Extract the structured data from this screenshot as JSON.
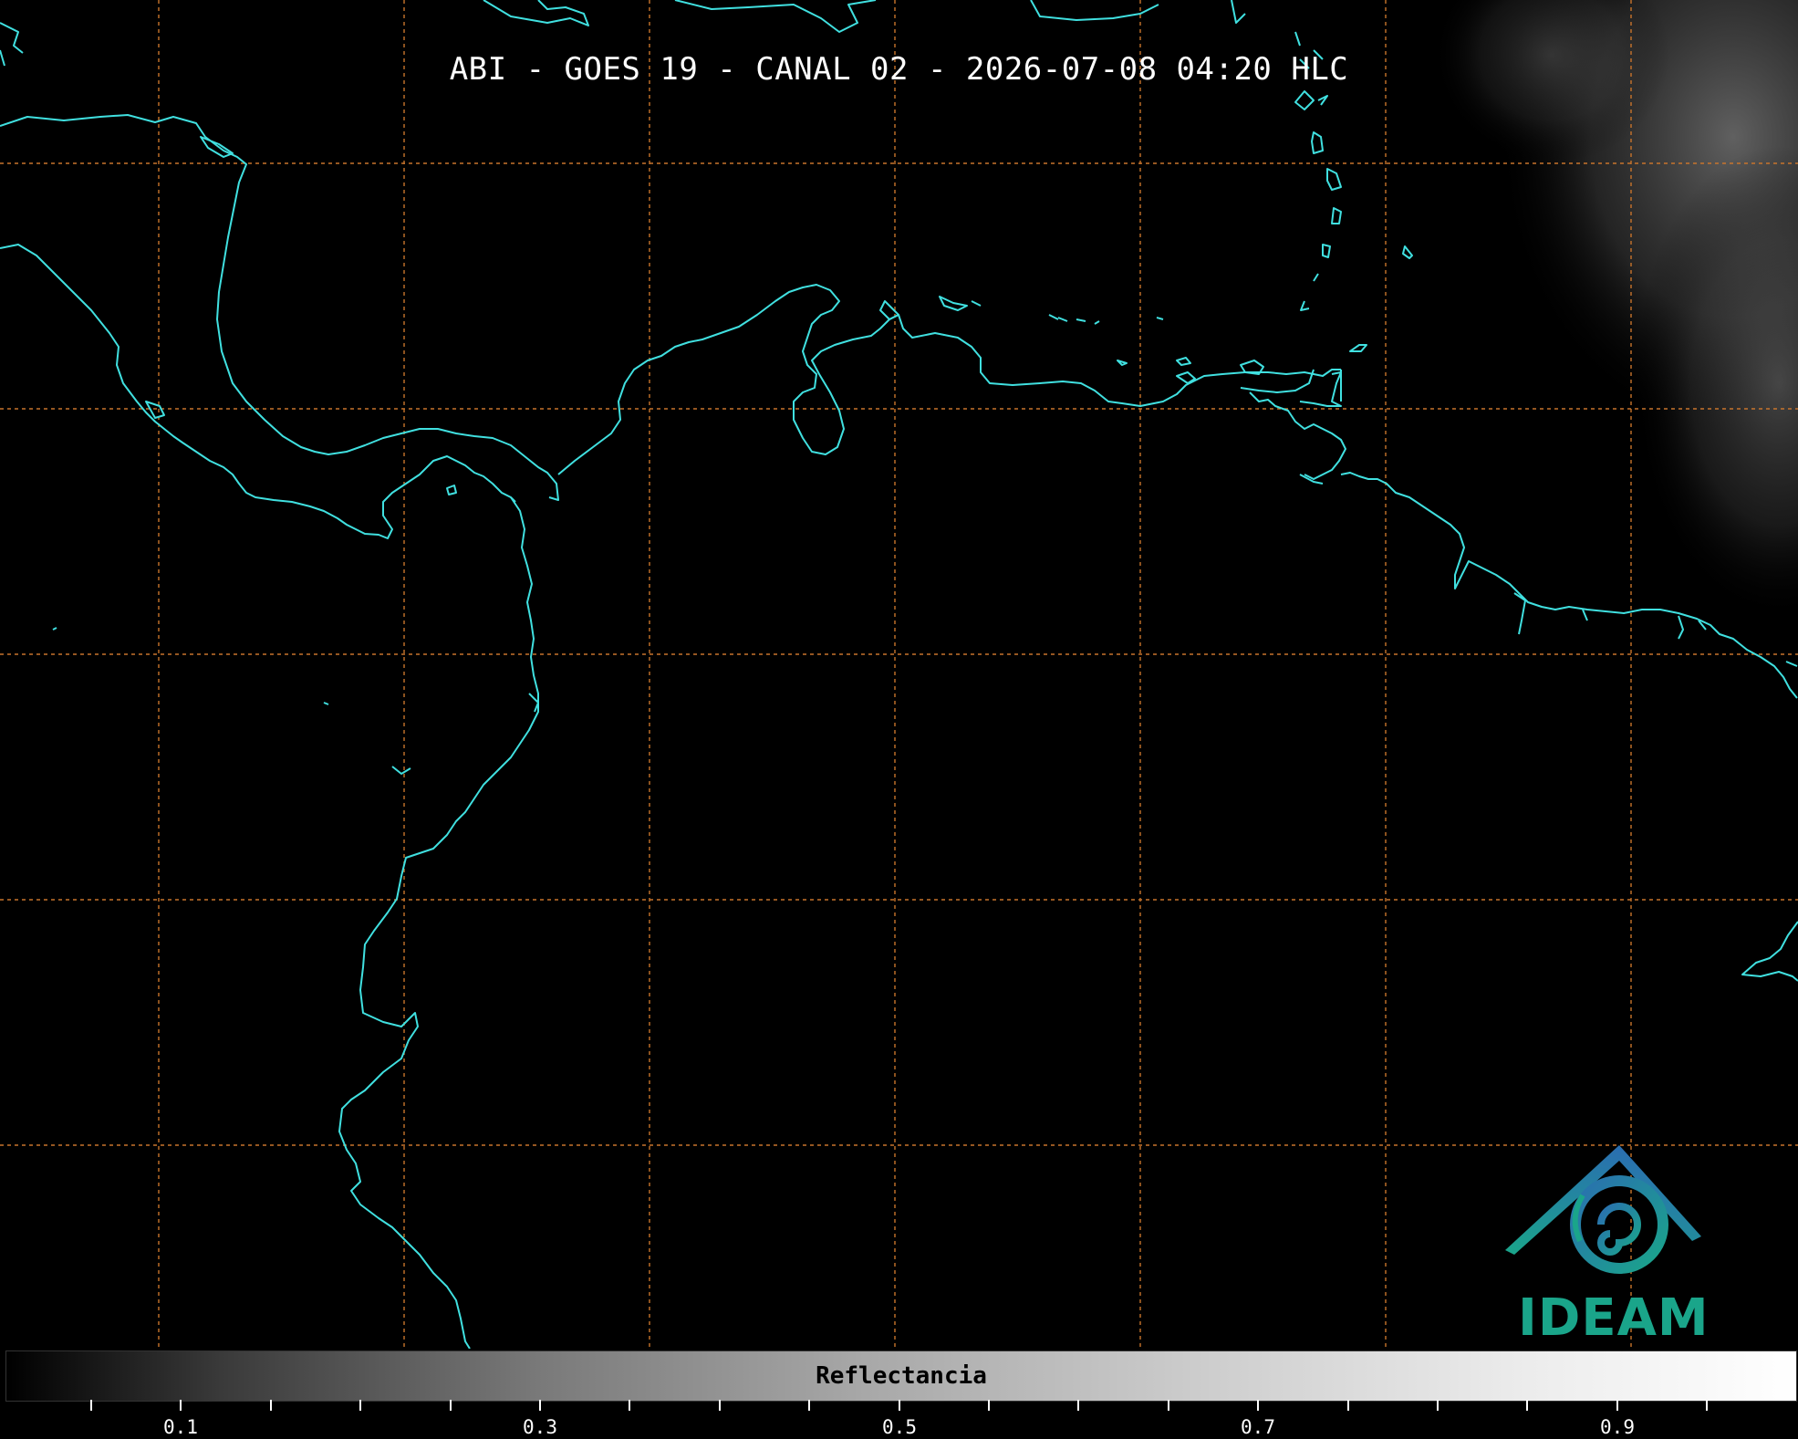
{
  "title": "ABI - GOES 19 - CANAL 02 - 2026-07-08 04:20 HLC",
  "colorbar": {
    "label": "Reflectancia",
    "ticks": [
      "0.1",
      "0.3",
      "0.5",
      "0.7",
      "0.9"
    ],
    "range": [
      0.0,
      1.0
    ]
  },
  "logo": {
    "text": "IDEAM"
  },
  "colors": {
    "coastline": "#40e0e0",
    "grid": "#c8742c",
    "logo_blue": "#2a6fb0",
    "logo_teal": "#1aa58a"
  }
}
